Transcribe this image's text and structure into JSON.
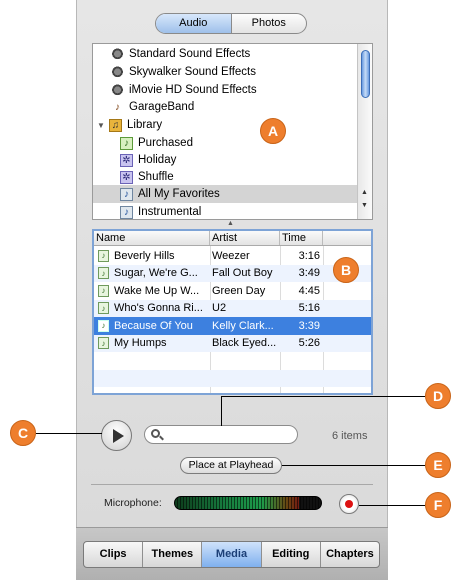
{
  "segmented": {
    "audio": "Audio",
    "photos": "Photos",
    "selected": "Audio"
  },
  "sources": [
    {
      "label": "Standard Sound Effects",
      "icon": "speaker-icon",
      "indent": 1
    },
    {
      "label": "Skywalker Sound Effects",
      "icon": "speaker-icon",
      "indent": 1
    },
    {
      "label": "iMovie HD Sound Effects",
      "icon": "speaker-icon",
      "indent": 1
    },
    {
      "label": "GarageBand",
      "icon": "guitar-icon",
      "indent": 1
    },
    {
      "label": "Library",
      "icon": "library-icon",
      "indent": 0,
      "expanded": true
    },
    {
      "label": "Purchased",
      "icon": "playlist-icon",
      "indent": 2
    },
    {
      "label": "Holiday",
      "icon": "smart-playlist-icon",
      "indent": 2
    },
    {
      "label": "Shuffle",
      "icon": "smart-playlist-icon",
      "indent": 2
    },
    {
      "label": "All My Favorites",
      "icon": "playlist-icon",
      "indent": 2,
      "selected": true
    },
    {
      "label": "Instrumental",
      "icon": "playlist-icon",
      "indent": 2
    }
  ],
  "table": {
    "headers": {
      "name": "Name",
      "artist": "Artist",
      "time": "Time"
    },
    "rows": [
      {
        "name": "Beverly Hills",
        "artist": "Weezer",
        "time": "3:16"
      },
      {
        "name": "Sugar, We're G...",
        "artist": "Fall Out Boy",
        "time": "3:49"
      },
      {
        "name": "Wake Me Up W...",
        "artist": "Green Day",
        "time": "4:45"
      },
      {
        "name": "Who's Gonna Ri...",
        "artist": "U2",
        "time": "5:16"
      },
      {
        "name": "Because Of You",
        "artist": "Kelly Clark...",
        "time": "3:39",
        "selected": true
      },
      {
        "name": "My Humps",
        "artist": "Black Eyed...",
        "time": "5:26"
      }
    ]
  },
  "search": {
    "value": "",
    "placeholder": ""
  },
  "item_count": "6 items",
  "place_button": "Place at Playhead",
  "microphone": {
    "label": "Microphone:",
    "level": 0.85
  },
  "tabs": [
    "Clips",
    "Themes",
    "Media",
    "Editing",
    "Chapters"
  ],
  "selected_tab": "Media",
  "callouts": {
    "a": "A",
    "b": "B",
    "c": "C",
    "d": "D",
    "e": "E",
    "f": "F"
  },
  "colors": {
    "callout": "#ee7e2d",
    "selection": "#3d80df",
    "record": "#dd1111"
  }
}
